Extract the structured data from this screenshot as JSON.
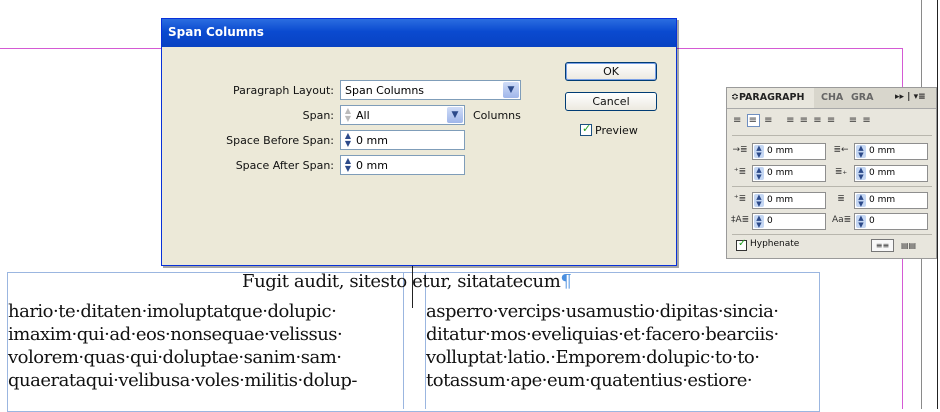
{
  "dialog": {
    "title": "Span Columns",
    "paragraph_layout_label": "Paragraph Layout:",
    "paragraph_layout_value": "Span Columns",
    "span_label": "Span:",
    "span_value": "All",
    "span_unit": "Columns",
    "space_before_label": "Space Before Span:",
    "space_before_value": "0 mm",
    "space_after_label": "Space After Span:",
    "space_after_value": "0 mm",
    "ok_label": "OK",
    "cancel_label": "Cancel",
    "preview_label": "Preview",
    "preview_checked": true
  },
  "panel": {
    "tabs": [
      {
        "label": "≎PARAGRAPH"
      },
      {
        "label": "CHA"
      },
      {
        "label": "GRA"
      }
    ],
    "menu_glyph": "▸▸ | ▾≡",
    "left_indent": "0 mm",
    "right_indent": "0 mm",
    "first_line_indent": "0 mm",
    "last_line_indent": "0 mm",
    "space_before": "0 mm",
    "space_after": "0 mm",
    "drop_cap_lines": "0",
    "drop_cap_chars": "0",
    "hyphenate_label": "Hyphenate",
    "hyphenate_checked": true
  },
  "document": {
    "heading": "Fugit audit, sitesto etur, sitatatecum",
    "heading_mark": "¶",
    "left_column": [
      "hario·te·ditaten·imoluptatque·dolupic·",
      "imaxim·qui·ad·eos·nonsequae·velissus·",
      "volorem·quas·qui·doluptae·sanim·sam·",
      "quaerataqui·velibusa·voles·militis·dolup-"
    ],
    "right_column": [
      "asperro·vercips·usamustio·dipitas·sincia·",
      "ditatur·mos·eveliquias·et·facero·bearciis·",
      "volluptat·latio.·Emporem·dolupic·to·to·",
      "totassum·ape·eum·quatentius·estiore·"
    ]
  },
  "colors": {
    "guide": "#d45ad4",
    "frame": "#9bb6e0",
    "title_bar": "#0a4ad0"
  }
}
